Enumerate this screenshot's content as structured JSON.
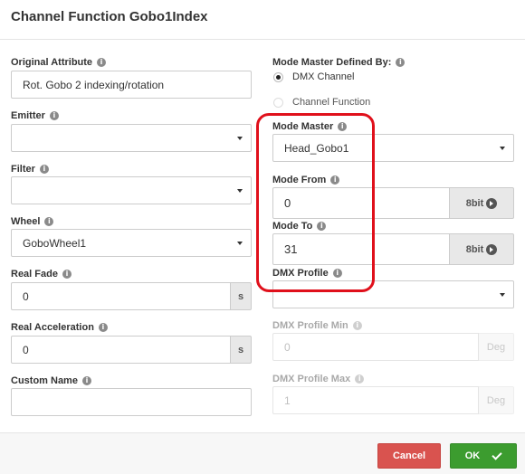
{
  "dialog": {
    "title": "Channel Function Gobo1Index"
  },
  "left": {
    "original_attribute": {
      "label": "Original Attribute",
      "value": "Rot. Gobo 2 indexing/rotation"
    },
    "emitter": {
      "label": "Emitter",
      "value": ""
    },
    "filter": {
      "label": "Filter",
      "value": ""
    },
    "wheel": {
      "label": "Wheel",
      "value": "GoboWheel1"
    },
    "real_fade": {
      "label": "Real Fade",
      "value": "0",
      "unit": "s"
    },
    "real_acceleration": {
      "label": "Real Acceleration",
      "value": "0",
      "unit": "s"
    },
    "custom_name": {
      "label": "Custom Name",
      "value": ""
    }
  },
  "right": {
    "mode_master_defined_by": {
      "label": "Mode Master Defined By:",
      "options": [
        "DMX Channel",
        "Channel Function"
      ],
      "selected": "DMX Channel"
    },
    "mode_master": {
      "label": "Mode Master",
      "value": "Head_Gobo1"
    },
    "mode_from": {
      "label": "Mode From",
      "value": "0",
      "addon": "8bit"
    },
    "mode_to": {
      "label": "Mode To",
      "value": "31",
      "addon": "8bit"
    },
    "dmx_profile": {
      "label": "DMX Profile",
      "value": ""
    },
    "dmx_profile_min": {
      "label": "DMX Profile Min",
      "value": "0",
      "unit": "Deg"
    },
    "dmx_profile_max": {
      "label": "DMX Profile Max",
      "value": "1",
      "unit": "Deg"
    }
  },
  "footer": {
    "cancel_label": "Cancel",
    "ok_label": "OK"
  },
  "colors": {
    "highlight": "#e0101b",
    "cancel": "#d9534f",
    "ok": "#3c9c2f"
  },
  "icons": {
    "info": "info-circle-icon",
    "bit": "chevron-right-circle-icon",
    "ok": "check-icon",
    "dropdown": "caret-down-icon"
  }
}
